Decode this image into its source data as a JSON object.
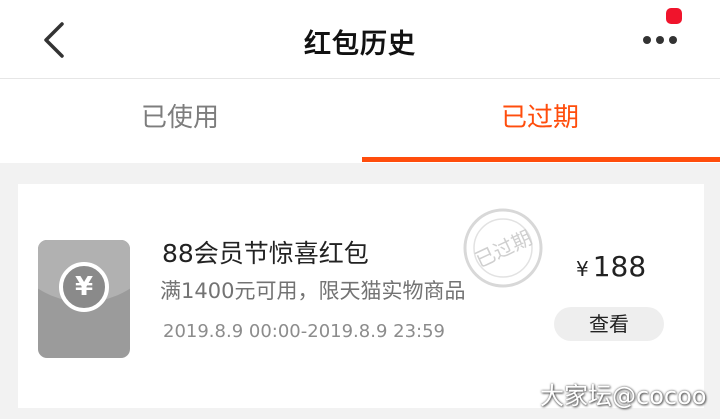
{
  "header": {
    "title": "红包历史"
  },
  "tabs": [
    {
      "label": "已使用",
      "active": false
    },
    {
      "label": "已过期",
      "active": true
    }
  ],
  "card": {
    "icon": "yuan-icon",
    "coin_symbol": "¥",
    "title": "88会员节惊喜红包",
    "condition": "满1400元可用，限天猫实物商品",
    "validity": "2019.8.9 00:00-2019.8.9 23:59",
    "stamp_text": "已过期",
    "currency": "¥",
    "amount": "188",
    "view_label": "查看"
  },
  "watermark": "大家坛@cocoo",
  "colors": {
    "accent": "#ff4d0c",
    "badge": "#f0142c",
    "packet": "#9b9b9b"
  }
}
